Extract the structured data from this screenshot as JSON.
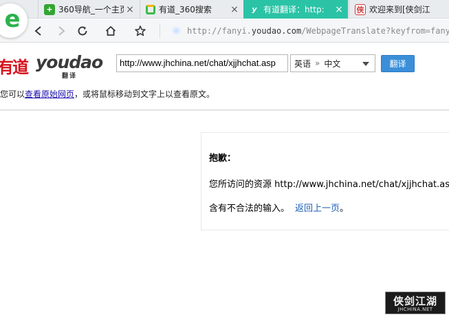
{
  "browser": {
    "logo_letter": "e",
    "tabs": [
      {
        "title": "360导航_一个主页",
        "icon": "360-navigation-icon",
        "close": "×"
      },
      {
        "title": "有道_360搜索",
        "icon": "360-search-icon",
        "close": "×"
      },
      {
        "title": "有道翻译：http:",
        "icon": "youdao-favicon",
        "favicon_text": "y",
        "close": "×",
        "active": true
      },
      {
        "title": "欢迎来到[侠剑江",
        "icon": "xiajian-favicon",
        "favicon_text": "侠",
        "close": "×"
      }
    ],
    "address": {
      "prefix": "http://fanyi.",
      "host": "youdao.com",
      "path": "/WebpageTranslate?keyfrom=fanyi"
    },
    "colors": {
      "active_tab": "#2bc3a6",
      "logo_green": "#2bb24c"
    }
  },
  "youdao": {
    "logo_cn": "有道",
    "logo_en": "youdao",
    "logo_sub": "翻译",
    "url_value": "http://www.jhchina.net/chat/xjjhchat.asp",
    "lang_from": "英语",
    "lang_sep": "»",
    "lang_to": "中文",
    "translate_label": "翻译",
    "hint_prefix": "您可以",
    "hint_link": "查看原始网页",
    "hint_suffix": "，或将鼠标移动到文字上以查看原文。",
    "colors": {
      "logo_red": "#d7121e",
      "button_blue": "#3b8fd9"
    }
  },
  "error": {
    "title": "抱歉：",
    "line1": "您所访问的资源 http://www.jhchina.net/chat/xjjhchat.asp",
    "line2": "含有不合法的输入。",
    "back_link": "返回上一页",
    "back_period": "。"
  },
  "stamp": {
    "cn": "侠剑江湖",
    "en": "JHCHINA.NET"
  }
}
